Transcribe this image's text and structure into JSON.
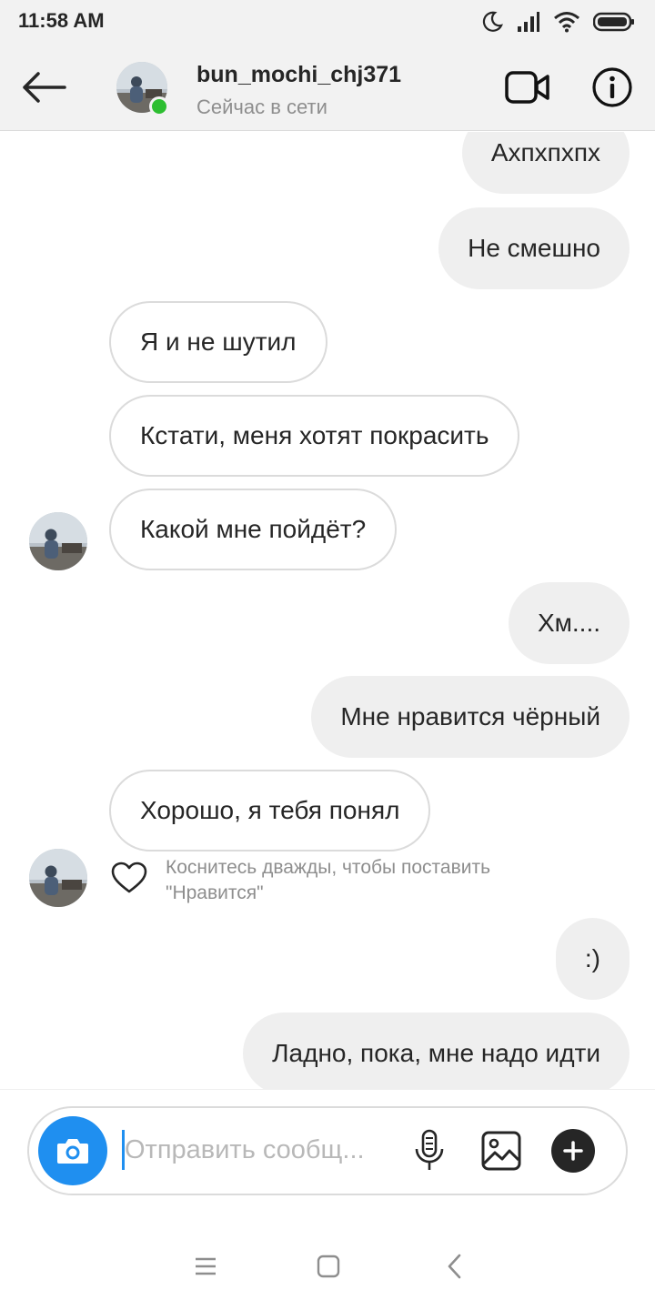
{
  "status_bar": {
    "time": "11:58 AM",
    "icons": [
      "moon-icon",
      "signal-icon",
      "wifi-icon",
      "battery-icon"
    ]
  },
  "header": {
    "username": "bun_mochi_chj371",
    "status": "Сейчас в сети",
    "icons": [
      "back-arrow-icon",
      "video-call-icon",
      "info-icon"
    ],
    "online_color": "#2dbe31"
  },
  "messages": [
    {
      "direction": "out",
      "text": "Ахпхпхпх"
    },
    {
      "direction": "out",
      "text": "Не смешно"
    },
    {
      "direction": "in",
      "text": "Я и не шутил"
    },
    {
      "direction": "in",
      "text": "Кстати, меня хотят покрасить"
    },
    {
      "direction": "in",
      "text": "Какой мне пойдёт?"
    },
    {
      "direction": "out",
      "text": "Хм...."
    },
    {
      "direction": "out",
      "text": "Мне нравится чёрный"
    },
    {
      "direction": "in",
      "text": "Хорошо, я тебя понял"
    },
    {
      "direction": "out",
      "text": ":)"
    },
    {
      "direction": "out",
      "text": "Ладно, пока, мне надо идти"
    }
  ],
  "like_hint": {
    "line1": "Коснитесь дважды, чтобы поставить",
    "line2": "\"Нравится\""
  },
  "composer": {
    "placeholder": "Отправить сообщ...",
    "value": "",
    "icons": [
      "camera-icon",
      "microphone-icon",
      "gallery-icon",
      "plus-icon"
    ],
    "camera_color": "#1f8ff0"
  },
  "nav_bar": {
    "icons": [
      "menu-icon",
      "home-icon",
      "back-icon"
    ]
  }
}
